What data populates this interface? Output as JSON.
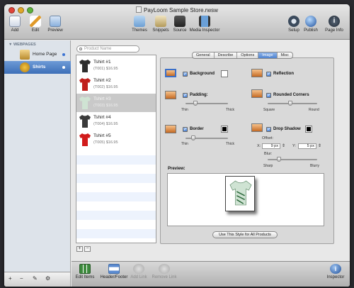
{
  "window": {
    "title": "PayLoom Sample Store.rwsw"
  },
  "toolbar": {
    "add": "Add",
    "edit": "Edit",
    "preview": "Preview",
    "themes": "Themes",
    "snippets": "Snippets",
    "source": "Source",
    "media_inspector": "Media Inspector",
    "setup": "Setup",
    "publish": "Publish",
    "page_info": "Page Info"
  },
  "sidebar": {
    "header": "▼ WEBPAGES",
    "items": [
      {
        "label": "Home Page"
      },
      {
        "label": "Shirts"
      }
    ]
  },
  "search": {
    "placeholder": "Product Name"
  },
  "products": [
    {
      "name": "Tshirt #1",
      "price": "(T001)  $16.95",
      "color": "#2e2e2e"
    },
    {
      "name": "Tshirt #2",
      "price": "(T002)  $16.95",
      "color": "#c0201c"
    },
    {
      "name": "Tshirt #3",
      "price": "(T003)  $16.95",
      "color": "#cfe3d3"
    },
    {
      "name": "Tshirt #4",
      "price": "(T004)  $16.95",
      "color": "#3a3a3a"
    },
    {
      "name": "Tshirt #5",
      "price": "(T005)  $16.95",
      "color": "#d11b1b"
    }
  ],
  "tabs": [
    "General",
    "Describe",
    "Options",
    "Image",
    "Misc"
  ],
  "selected_tab": "Image",
  "effects": {
    "background": "Background",
    "reflection": "Reflection",
    "padding": "Padding:",
    "padding_min": "Thin",
    "padding_max": "Thick",
    "padding_level": 0.2,
    "rounded_corners": "Rounded Corners",
    "corners_min": "Square",
    "corners_max": "Round",
    "corners_level": 0.45,
    "border": "Border",
    "border_min": "Thin",
    "border_max": "Thick",
    "border_level": 0.15,
    "drop_shadow": "Drop Shadow",
    "offset": "Offset:",
    "x_label": "X:",
    "x_value": "9 px",
    "y_label": "Y:",
    "y_value": "5 px",
    "blur": "Blur:",
    "blur_min": "Sharp",
    "blur_max": "Blurry",
    "blur_level": 0.2
  },
  "preview": {
    "label": "Preview:"
  },
  "use_style_button": "Use This Style for All Products",
  "bottom": {
    "edit_items": "Edit Items",
    "header_footer": "Header/Footer",
    "add_link": "Add Link",
    "remove_link": "Remove Link",
    "inspector": "Inspector"
  },
  "list_buttons": {
    "add": "+",
    "remove": "−"
  },
  "colors": {
    "selection_blue": "#3d6fb8",
    "tab_selected": "#4f83cf"
  }
}
